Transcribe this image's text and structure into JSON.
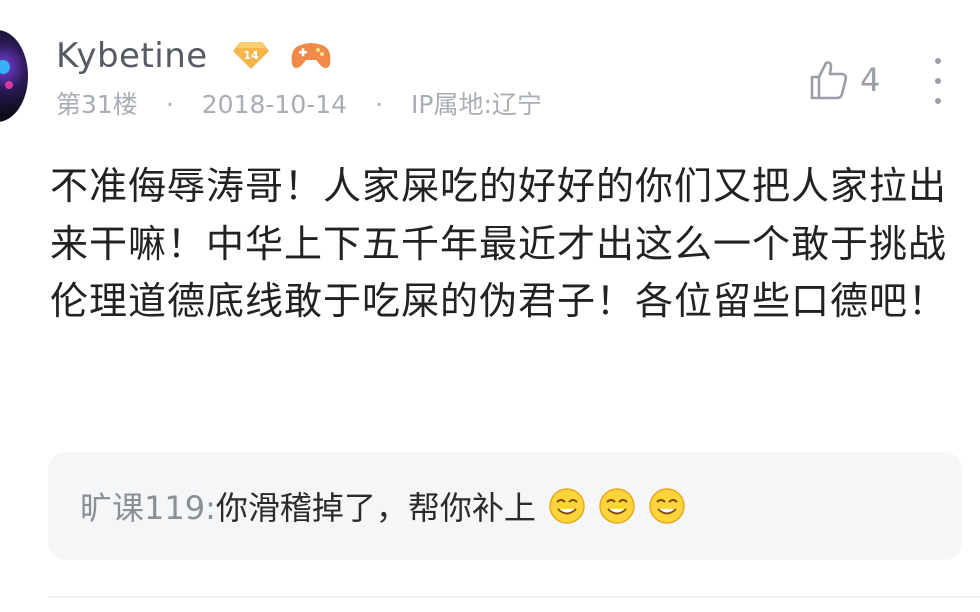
{
  "comment": {
    "username": "Kybetine",
    "level": "14",
    "floor": "第31楼",
    "separator": "·",
    "date": "2018-10-14",
    "ip_location": "IP属地:辽宁",
    "like_count": "4",
    "body": "不准侮辱涛哥！人家屎吃的好好的你们又把人家拉出来干嘛！中华上下五千年最近才出这么一个敢于挑战伦理道德底线敢于吃屎的伪君子！各位留些口德吧！",
    "icons": {
      "level_badge": "level-diamond-icon",
      "game_badge": "gamepad-icon",
      "like": "thumbs-up-icon",
      "more": "more-vertical-icon"
    }
  },
  "reply": {
    "author": "旷课119: ",
    "text": "你滑稽掉了，帮你补上",
    "emoji": "funny-face-emoji"
  },
  "colors": {
    "badge_gold": "#f4b64a",
    "game_orange": "#f08a4b",
    "muted": "#a9adb4",
    "reply_bg": "#f5f6f8"
  }
}
